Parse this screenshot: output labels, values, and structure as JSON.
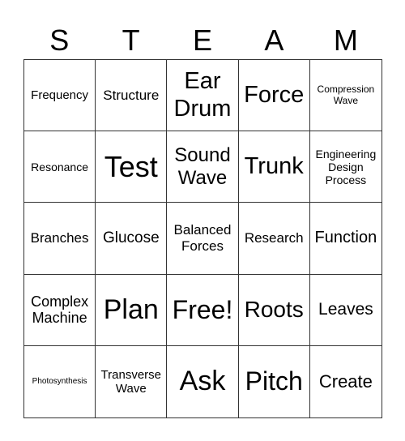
{
  "header": [
    "S",
    "T",
    "E",
    "A",
    "M"
  ],
  "cells": [
    {
      "text": "Frequency",
      "size": 15
    },
    {
      "text": "Structure",
      "size": 17
    },
    {
      "text": "Ear Drum",
      "size": 29
    },
    {
      "text": "Force",
      "size": 29
    },
    {
      "text": "Compression Wave",
      "size": 12
    },
    {
      "text": "Resonance",
      "size": 14
    },
    {
      "text": "Test",
      "size": 36
    },
    {
      "text": "Sound Wave",
      "size": 24
    },
    {
      "text": "Trunk",
      "size": 29
    },
    {
      "text": "Engineering Design Process",
      "size": 14
    },
    {
      "text": "Branches",
      "size": 17
    },
    {
      "text": "Glucose",
      "size": 19
    },
    {
      "text": "Balanced Forces",
      "size": 17
    },
    {
      "text": "Research",
      "size": 17
    },
    {
      "text": "Function",
      "size": 20
    },
    {
      "text": "Complex Machine",
      "size": 18
    },
    {
      "text": "Plan",
      "size": 34
    },
    {
      "text": "Free!",
      "size": 32
    },
    {
      "text": "Roots",
      "size": 28
    },
    {
      "text": "Leaves",
      "size": 21
    },
    {
      "text": "Photosynthesis",
      "size": 10
    },
    {
      "text": "Transverse Wave",
      "size": 15
    },
    {
      "text": "Ask",
      "size": 34
    },
    {
      "text": "Pitch",
      "size": 32
    },
    {
      "text": "Create",
      "size": 22
    }
  ]
}
